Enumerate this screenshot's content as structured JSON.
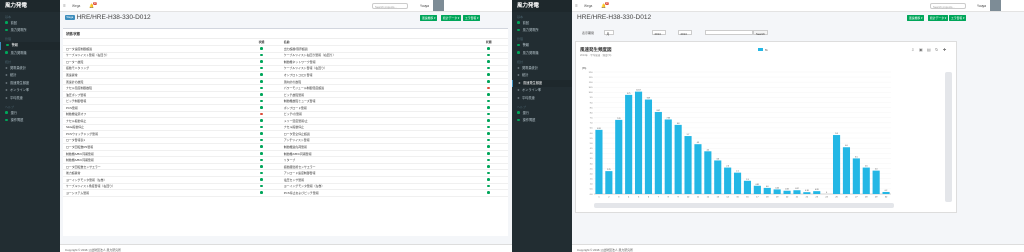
{
  "brand": "風力発電",
  "sidebar": {
    "section1": "基本",
    "section2": "管理",
    "section3": "統計",
    "section4": "ヘルプ",
    "items": [
      {
        "label": "前回",
        "section": 1,
        "color": "#00a65a"
      },
      {
        "label": "風力発電所",
        "section": 1,
        "color": "#00a65a"
      },
      {
        "label": "警報",
        "section": 2,
        "color": "#00a65a"
      },
      {
        "label": "風力発電機",
        "section": 2,
        "color": "#00a65a"
      },
      {
        "label": "発電量統計",
        "section": 3,
        "icon": "≡"
      },
      {
        "label": "統計",
        "section": 3,
        "icon": "≡"
      },
      {
        "label": "風速発生頻度",
        "section": 3,
        "icon": "≡"
      },
      {
        "label": "オンライン率",
        "section": 3,
        "icon": "≡"
      },
      {
        "label": "平均風速",
        "section": 3,
        "icon": "≡"
      },
      {
        "label": "運行",
        "section": 4,
        "color": "#00a65a"
      },
      {
        "label": "操作問題",
        "section": 4,
        "color": "#00a65a"
      }
    ]
  },
  "topbar": {
    "menu_label": "Wega",
    "search_placeholder": "Search projects...",
    "user": "Yuuya",
    "notifications": "13"
  },
  "page": {
    "tag": "Wega",
    "title_left": "HRE/HRE-H38-330-D012",
    "title_right": "HRE/HRE-H38-330-D012",
    "btn1": "風速推移 ▾",
    "btn2": "統計データ ▾",
    "btn3": "エラ警報 ▾"
  },
  "status_table": {
    "title": "状態/状態",
    "headers": [
      "",
      "状態",
      "名前",
      "状態"
    ],
    "rows": [
      [
        "ロータ速度制御超過",
        "#00a65a",
        "出力超越/限界超過",
        "#00a65a"
      ],
      [
        "ケーブルツイスト警報（右回り）",
        "#00a65a",
        "ケーブルツイスト右回り警報（右回り）",
        "#00a65a"
      ],
      [
        "ローター故障",
        "#00a65a",
        "制動機ネットワーク警報",
        "#00a65a"
      ],
      [
        "振動モニタリング",
        "#00a65a",
        "ケーブルツイスト警報（右回り）",
        "#00a65a"
      ],
      [
        "風速異常",
        "#00a65a",
        "オンプロトコ(ロ) 警報",
        "#00a65a"
      ],
      [
        "風速計の故障",
        "#00a65a",
        "風向計の故障",
        "#00a65a"
      ],
      [
        "ナセル温度制御故障",
        "#00a65a",
        "パワーモジュール制御温度超過",
        "#dd4b39"
      ],
      [
        "油圧ポンプ警報",
        "#00a65a",
        "ピッチ故障警報",
        "#00a65a"
      ],
      [
        "ピッチ制御警報",
        "#00a65a",
        "制動機故障ヒューズ警報",
        "#00a65a"
      ],
      [
        "PCS警報",
        "#00a65a",
        "ボンプロード警報",
        "#00a65a"
      ],
      [
        "制動機電源オフ",
        "#dd4b39",
        "ピッチ/の警報",
        "#00a65a"
      ],
      [
        "ナセル振動停止",
        "#00a65a",
        "メリー温度警報/止",
        "#00a65a"
      ],
      [
        "Slide振動停止",
        "#00a65a",
        "ナセル振動停止",
        "#00a65a"
      ],
      [
        "PCSウォッチドッグ警報",
        "#00a65a",
        "ロータ安全停止超過",
        "#00a65a"
      ],
      [
        "ロータ警報表1",
        "#00a65a",
        "アンチツイスト警報",
        "#00a65a"
      ],
      [
        "ロータ回転数RS警報",
        "#00a65a",
        "制動機過負荷警報",
        "#00a65a"
      ],
      [
        "制動機A/B/C同期警報",
        "#00a65a",
        "制動機A/B/C同期警報",
        "#00a65a"
      ],
      [
        "制動機A/B/C同期警報",
        "#00a65a",
        "リターブ",
        "#00a65a"
      ],
      [
        "ロータ回転数センサエラー",
        "#00a65a",
        "振動器監視センサエラー",
        "#00a65a"
      ],
      [
        "後力超異常",
        "#00a65a",
        "アンロード速度制御警報",
        "#00a65a"
      ],
      [
        "ヨーイングモンタ警報（左巻）",
        "#00a65a",
        "電圧センサ警報",
        "#00a65a"
      ],
      [
        "ケーブルツイスト角度警報（右回り）",
        "#00a65a",
        "ヨーイングモンタ警報（左巻）",
        "#00a65a"
      ],
      [
        "ヨーシステム警報",
        "#00a65a",
        "PCS停止およびピッチ警報",
        "#00a65a"
      ]
    ]
  },
  "filters": {
    "label": "表示期間",
    "unit": "月",
    "year": "2014",
    "month": "2014",
    "search": "Search"
  },
  "chart_data": {
    "type": "bar",
    "title": "風速発生頻度図",
    "subtitle": "2014年 · 平均風速 · 頻度(%)",
    "legend": "%",
    "ylabel": "(%)",
    "ylim": [
      0,
      12
    ],
    "categories": [
      "1",
      "2",
      "3",
      "4",
      "5",
      "6",
      "7",
      "8",
      "9",
      "10",
      "11",
      "12",
      "13",
      "14",
      "15",
      "16",
      "17",
      "18",
      "19",
      "20",
      "21",
      "22",
      "23",
      "24",
      "25",
      "26",
      "27",
      "28",
      "29",
      "30"
    ],
    "values": [
      6.31,
      2.25,
      7.29,
      9.75,
      10.07,
      9.29,
      8.07,
      7.33,
      6.8,
      5.7,
      4.9,
      4.2,
      3.3,
      2.6,
      2.1,
      1.3,
      0.81,
      0.6,
      0.45,
      0.32,
      0.37,
      0.18,
      0.28,
      0,
      5.8,
      4.6,
      3.5,
      2.6,
      2.3,
      0.2
    ],
    "color": "#23b7e5"
  },
  "footer": "Copyright © 2016 公益財団法人 風力研究所"
}
